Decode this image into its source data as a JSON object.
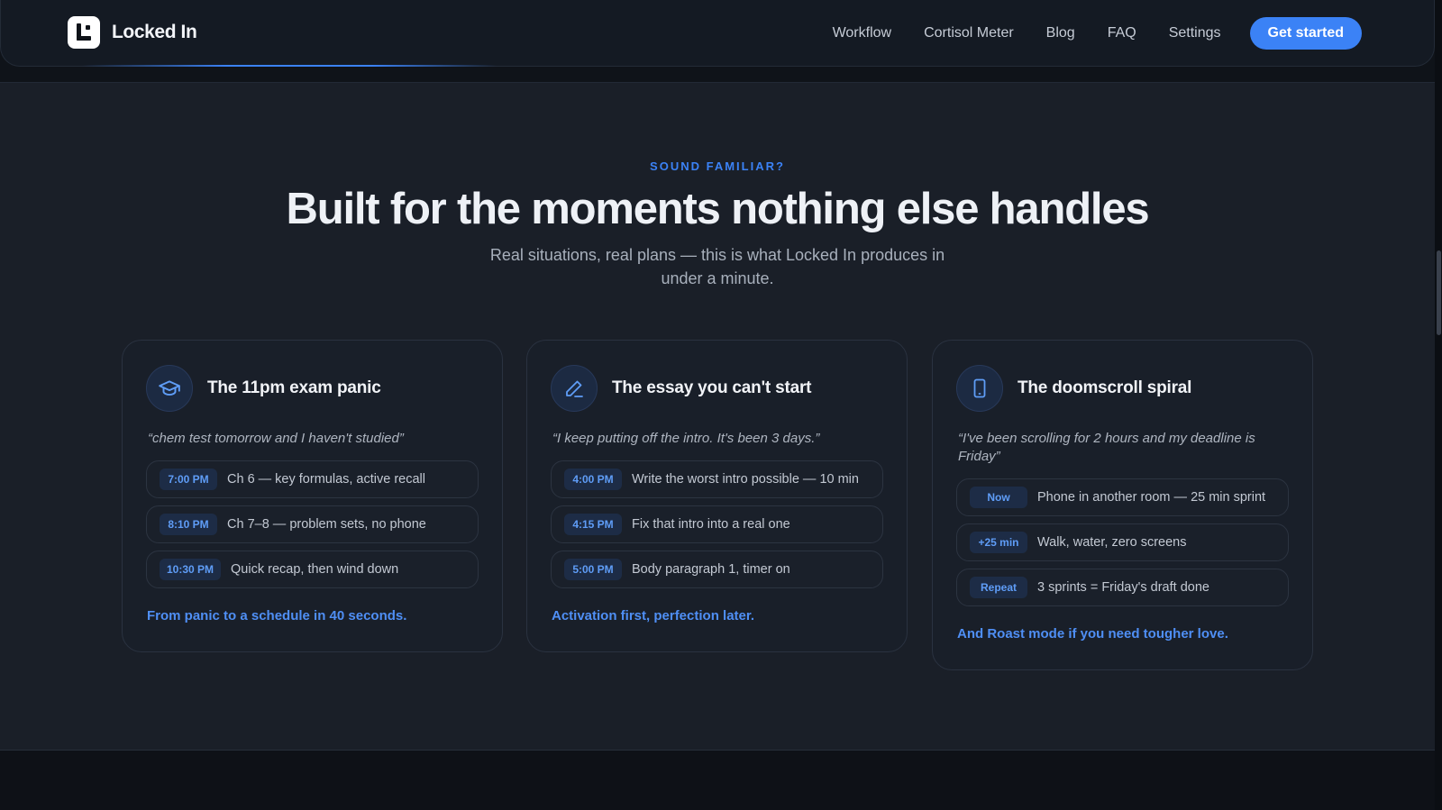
{
  "app": {
    "name": "Locked In"
  },
  "nav": {
    "links": [
      "Workflow",
      "Cortisol Meter",
      "Blog",
      "FAQ",
      "Settings"
    ],
    "cta_label": "Get started"
  },
  "colors": {
    "accent": "#3b82f6",
    "page_bg": "#1a1f28",
    "card_bg": "#191f29"
  },
  "section": {
    "eyebrow": "SOUND FAMILIAR?",
    "title": "Built for the moments nothing else handles",
    "subtitle": "Real situations, real plans — this is what Locked In produces in under a minute."
  },
  "cards": [
    {
      "icon": "graduation-cap-icon",
      "title": "The 11pm exam panic",
      "quote": "“chem test tomorrow and I haven't studied”",
      "rows": [
        {
          "tag": "7:00 PM",
          "text": "Ch 6 — key formulas, active recall"
        },
        {
          "tag": "8:10 PM",
          "text": "Ch 7–8 — problem sets, no phone"
        },
        {
          "tag": "10:30 PM",
          "text": "Quick recap, then wind down"
        }
      ],
      "footer": "From panic to a schedule in 40 seconds."
    },
    {
      "icon": "pencil-icon",
      "title": "The essay you can't start",
      "quote": "“I keep putting off the intro. It's been 3 days.”",
      "rows": [
        {
          "tag": "4:00 PM",
          "text": "Write the worst intro possible — 10 min"
        },
        {
          "tag": "4:15 PM",
          "text": "Fix that intro into a real one"
        },
        {
          "tag": "5:00 PM",
          "text": "Body paragraph 1, timer on"
        }
      ],
      "footer": "Activation first, perfection later."
    },
    {
      "icon": "phone-icon",
      "title": "The doomscroll spiral",
      "quote": "“I've been scrolling for 2 hours and my deadline is Friday”",
      "rows": [
        {
          "tag": "Now",
          "text": "Phone in another room — 25 min sprint"
        },
        {
          "tag": "+25 min",
          "text": "Walk, water, zero screens"
        },
        {
          "tag": "Repeat",
          "text": "3 sprints = Friday's draft done"
        }
      ],
      "footer": "And Roast mode if you need tougher love."
    }
  ]
}
